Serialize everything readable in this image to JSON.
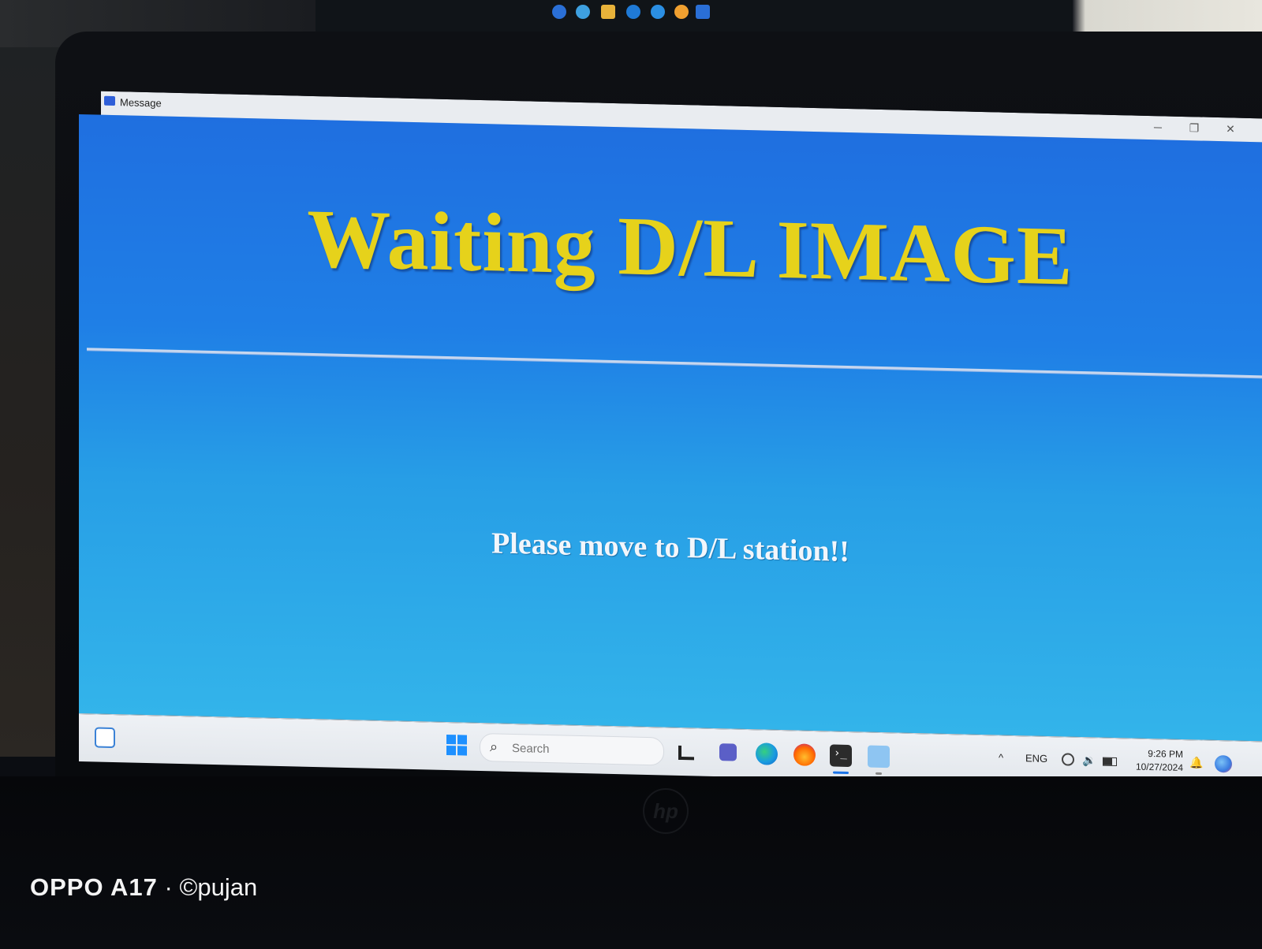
{
  "window": {
    "title": "Message",
    "controls": {
      "minimize": "─",
      "restore": "❐",
      "close": "✕"
    }
  },
  "dialog": {
    "headline": "Waiting D/L IMAGE",
    "message": "Please move to D/L station!!",
    "colors": {
      "background_top": "#1f6fe0",
      "background_bottom": "#33b4ea",
      "headline": "#e6d21b",
      "message": "#f2f6fb"
    }
  },
  "taskbar": {
    "search_placeholder": "Search",
    "tray": {
      "language": "ENG",
      "time": "9:26 PM",
      "date": "10/27/2024",
      "chevron": "^"
    },
    "apps": [
      "widgets-icon",
      "start-icon",
      "task-view-icon",
      "teams-icon",
      "edge-icon",
      "firefox-icon",
      "terminal-icon",
      "chat-icon"
    ]
  },
  "photo_watermark": {
    "device": "OPPO A17",
    "separator": "·",
    "credit": "©pujan"
  }
}
